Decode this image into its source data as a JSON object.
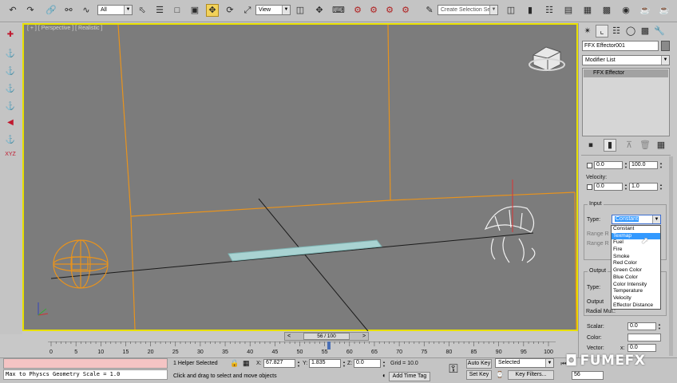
{
  "toolbar": {
    "selection_filter": "All",
    "reference_coord": "View",
    "named_selection_placeholder": "Create Selection Se"
  },
  "viewport": {
    "label": "[ + ] [ Perspective ] [ Realistic ]",
    "label_plus": "[ + ]",
    "label_view": "[ Perspective ]",
    "label_shading": "[ Realistic ]"
  },
  "command_panel": {
    "object_name": "FFX Effector001",
    "object_color": "#8a8a8a",
    "modifier_list": "Modifier List",
    "stack_item": "FFX Effector"
  },
  "params": {
    "range_min": "0.0",
    "range_max": "100.0",
    "velocity_label": "Velocity:",
    "velocity_min": "0.0",
    "velocity_max": "1.0",
    "input_group": "Input",
    "type_label": "Type:",
    "type_selected": "Constant",
    "range_partial_1": "Range R",
    "range_partial_2": "Range R",
    "output_group": "Output",
    "output_type_label": "Type:",
    "output_partial": "Output",
    "radial_mul_label": "Radial Mul.:",
    "scalar_label": "Scalar:",
    "scalar_value": "0.0",
    "color_label": "Color:",
    "vector_label": "Vector:",
    "vector_x_label": "x:",
    "vector_x_value": "0.0"
  },
  "type_dropdown": {
    "options": [
      "Constant",
      "Texmap",
      "Fuel",
      "Fire",
      "Smoke",
      "Red Color",
      "Green Color",
      "Blue Color",
      "Color Intensity",
      "Temperature",
      "Velocity",
      "Effector Distance"
    ],
    "highlighted": "Texmap"
  },
  "timeline": {
    "slider": "56 / 100",
    "ticks": [
      "0",
      "5",
      "10",
      "15",
      "20",
      "25",
      "30",
      "35",
      "40",
      "45",
      "50",
      "55",
      "60",
      "65",
      "70",
      "75",
      "80",
      "85",
      "90",
      "95",
      "100"
    ]
  },
  "status": {
    "maxscript": "Max to Physcs Geometry Scale = 1.0",
    "selection": "1 Helper Selected",
    "prompt": "Click and drag to select and move objects",
    "x_label": "X:",
    "x_value": "67.827",
    "y_label": "Y:",
    "y_value": "1.835",
    "z_label": "Z:",
    "z_value": "0.0",
    "grid": "Grid = 10.0",
    "add_time_tag": "Add Time Tag",
    "auto_key": "Auto Key",
    "set_key": "Set Key",
    "key_mode": "Selected",
    "key_filters": "Key Filters...",
    "frame": "56"
  },
  "watermark": {
    "text": "FUMEFX"
  },
  "colors": {
    "viewport_bg": "#7c7c7c",
    "viewport_border": "#e8e000",
    "selection_orange": "#e8931d",
    "stack_highlight": "#a2a2a2",
    "list_highlight": "#3399ff",
    "watermark": "#ffffff"
  }
}
